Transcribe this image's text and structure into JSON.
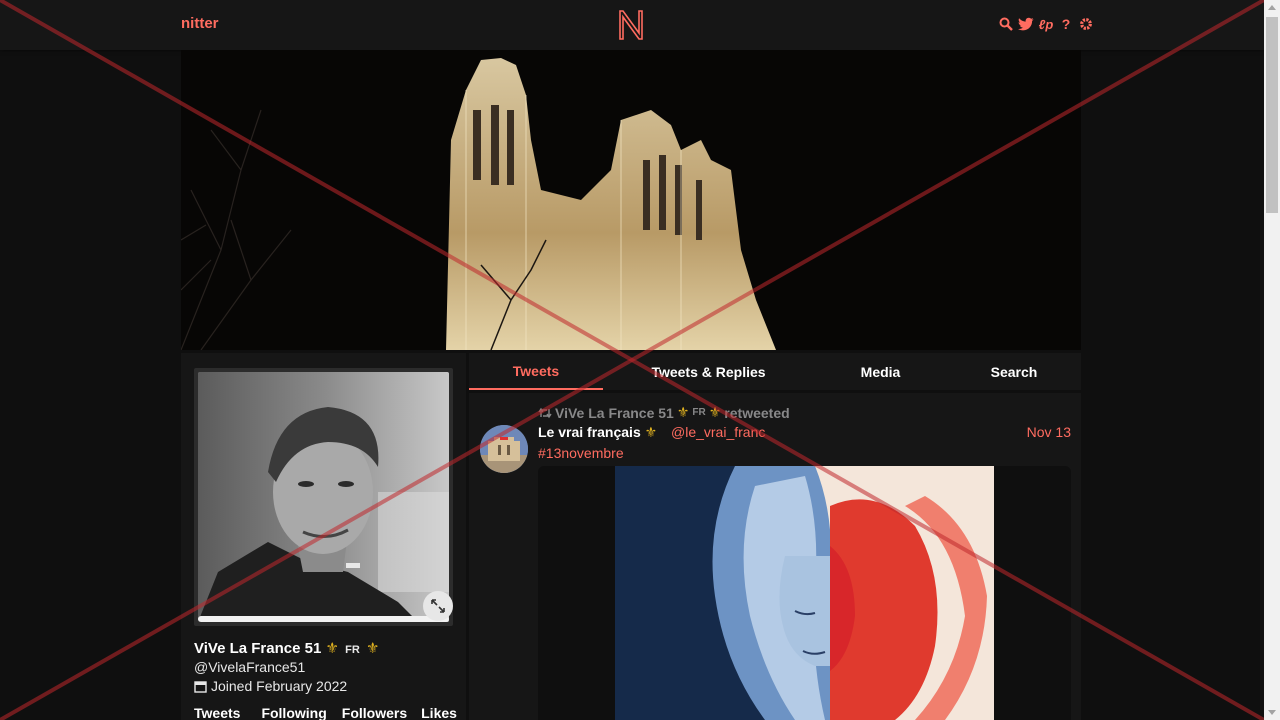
{
  "navbar": {
    "brand": "nitter",
    "logo_letter": "N",
    "icons": [
      "search-icon",
      "twitter-bird-icon",
      "rss-icon",
      "help-icon",
      "gear-icon"
    ],
    "accent_color": "#ff6c60"
  },
  "profile": {
    "fullname": "ViVe La France 51",
    "badge": "⚜",
    "flag": "FR",
    "username": "@VivelaFrance51",
    "joined": "Joined February 2022",
    "stats": [
      "Tweets",
      "Following",
      "Followers",
      "Likes"
    ]
  },
  "tabs": [
    {
      "label": "Tweets",
      "active": true
    },
    {
      "label": "Tweets & Replies",
      "active": false
    },
    {
      "label": "Media",
      "active": false
    },
    {
      "label": "Search",
      "active": false
    }
  ],
  "tweet": {
    "retweeter": "ViVe La France 51",
    "flag": "FR",
    "badge": "⚜",
    "retweeted": "retweeted",
    "fullname": "Le vrai français",
    "username": "@le_vrai_franc",
    "date": "Nov 13",
    "hashtag": "#13novembre"
  }
}
